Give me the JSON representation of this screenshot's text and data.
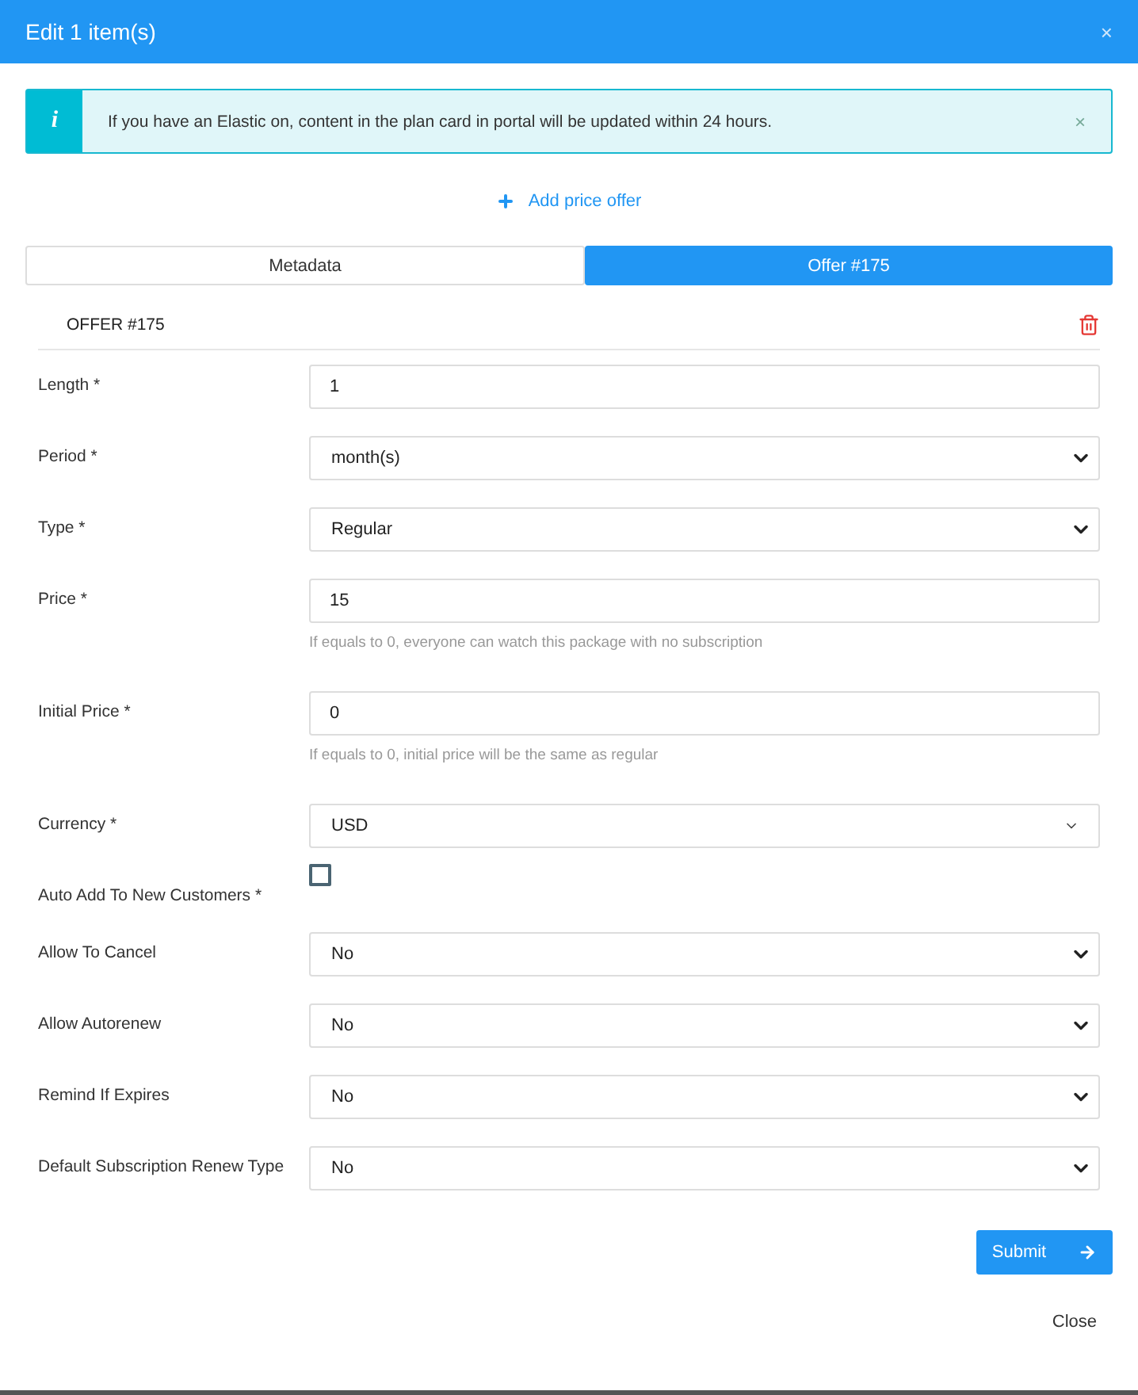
{
  "window": {
    "title": "Edit 1 item(s)",
    "close": "×"
  },
  "alert": {
    "icon": "i",
    "text": "If you have an Elastic on, content in the plan card in portal will be updated within 24 hours.",
    "close": "×"
  },
  "add_offer": "Add price offer",
  "tabs": [
    {
      "label": "Metadata",
      "selected": false
    },
    {
      "label": "Offer #175",
      "selected": true
    }
  ],
  "offer": {
    "title": "OFFER #175"
  },
  "fields": [
    {
      "kind": "input",
      "label": "Length *",
      "value": "1"
    },
    {
      "kind": "select",
      "label": "Period *",
      "value": "month(s)"
    },
    {
      "kind": "select",
      "label": "Type *",
      "value": "Regular"
    },
    {
      "kind": "input",
      "label": "Price *",
      "value": "15",
      "hint": "If equals to 0, everyone can watch this package with no subscription"
    },
    {
      "kind": "input",
      "label": "Initial Price *",
      "value": "0",
      "hint": "If equals to 0, initial price will be the same as regular"
    },
    {
      "kind": "dropdown",
      "label": "Currency *",
      "value": "USD"
    },
    {
      "kind": "checkbox",
      "label": "Auto Add To New Customers *",
      "checked": false
    },
    {
      "kind": "select",
      "label": "Allow To Cancel",
      "value": "No"
    },
    {
      "kind": "select",
      "label": "Allow Autorenew",
      "value": "No"
    },
    {
      "kind": "select",
      "label": "Remind If Expires",
      "value": "No"
    },
    {
      "kind": "select",
      "label": "Default Subscription Renew Type",
      "value": "No"
    }
  ],
  "submit": "Submit",
  "close": "Close"
}
